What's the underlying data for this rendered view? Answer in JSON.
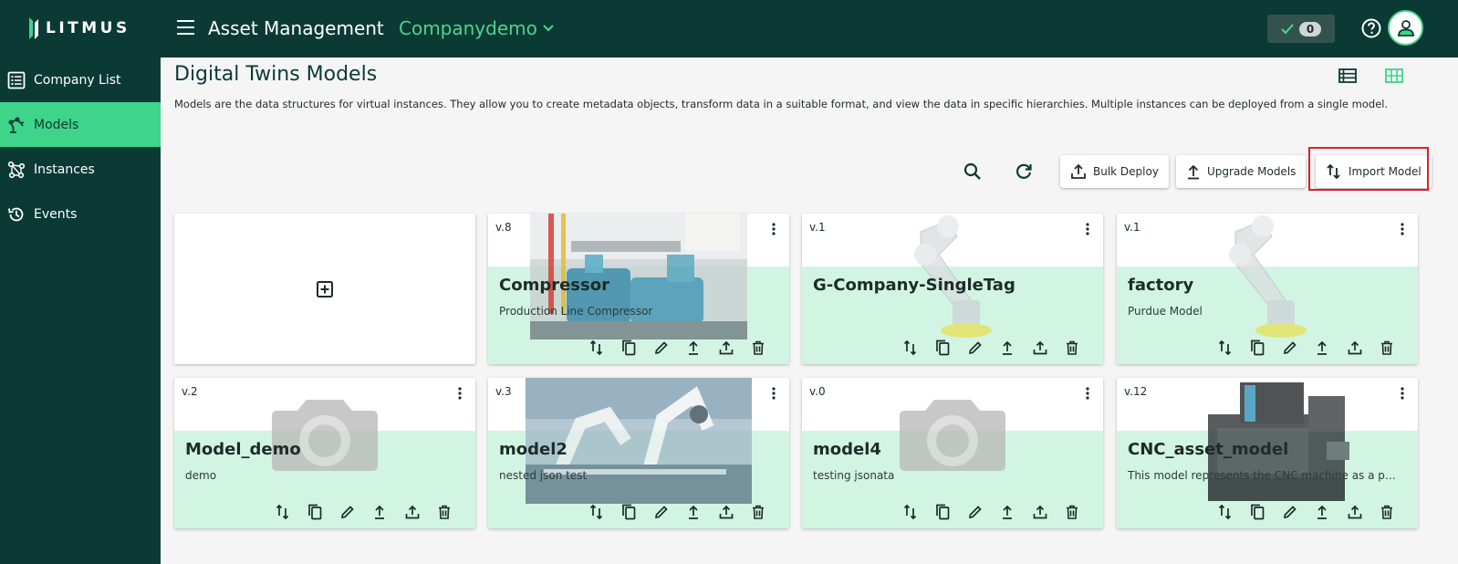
{
  "brand": {
    "name": "LITMUS"
  },
  "header": {
    "title": "Asset Management",
    "company": "Companydemo",
    "notification_count": "0"
  },
  "sidebar": {
    "items": [
      {
        "label": "Company List",
        "icon": "list-icon",
        "active": false
      },
      {
        "label": "Models",
        "icon": "robot-arm-icon",
        "active": true
      },
      {
        "label": "Instances",
        "icon": "network-icon",
        "active": false
      },
      {
        "label": "Events",
        "icon": "history-icon",
        "active": false
      }
    ]
  },
  "page": {
    "title": "Digital Twins Models",
    "description": "Models are the data structures for virtual instances. They allow you to create metadata objects, transform data in a suitable format, and view the data in specific hierarchies. Multiple instances can be deployed from a single model."
  },
  "toolbar": {
    "bulk_deploy": "Bulk Deploy",
    "upgrade_models": "Upgrade Models",
    "import_model": "Import Model"
  },
  "colors": {
    "primary_dark": "#0b3a34",
    "accent_green": "#3ed48a",
    "card_band": "#d2f5e3",
    "highlight_red": "#d8232a"
  },
  "models": [
    {
      "version": "v.8",
      "name": "Compressor",
      "description": "Production Line Compressor",
      "image": "compressor-photo"
    },
    {
      "version": "v.1",
      "name": "G-Company-SingleTag",
      "description": "",
      "image": "robot-arm-photo"
    },
    {
      "version": "v.1",
      "name": "factory",
      "description": "Purdue Model",
      "image": "robot-arm-photo"
    },
    {
      "version": "v.2",
      "name": "Model_demo",
      "description": "demo",
      "image": "camera-placeholder"
    },
    {
      "version": "v.3",
      "name": "model2",
      "description": "nested json test",
      "image": "factory-robots-photo"
    },
    {
      "version": "v.0",
      "name": "model4",
      "description": "testing jsonata",
      "image": "camera-placeholder"
    },
    {
      "version": "v.12",
      "name": "CNC_asset_model",
      "description": "This model represents the CNC machine as a phy...",
      "image": "cnc-machine-photo"
    }
  ]
}
